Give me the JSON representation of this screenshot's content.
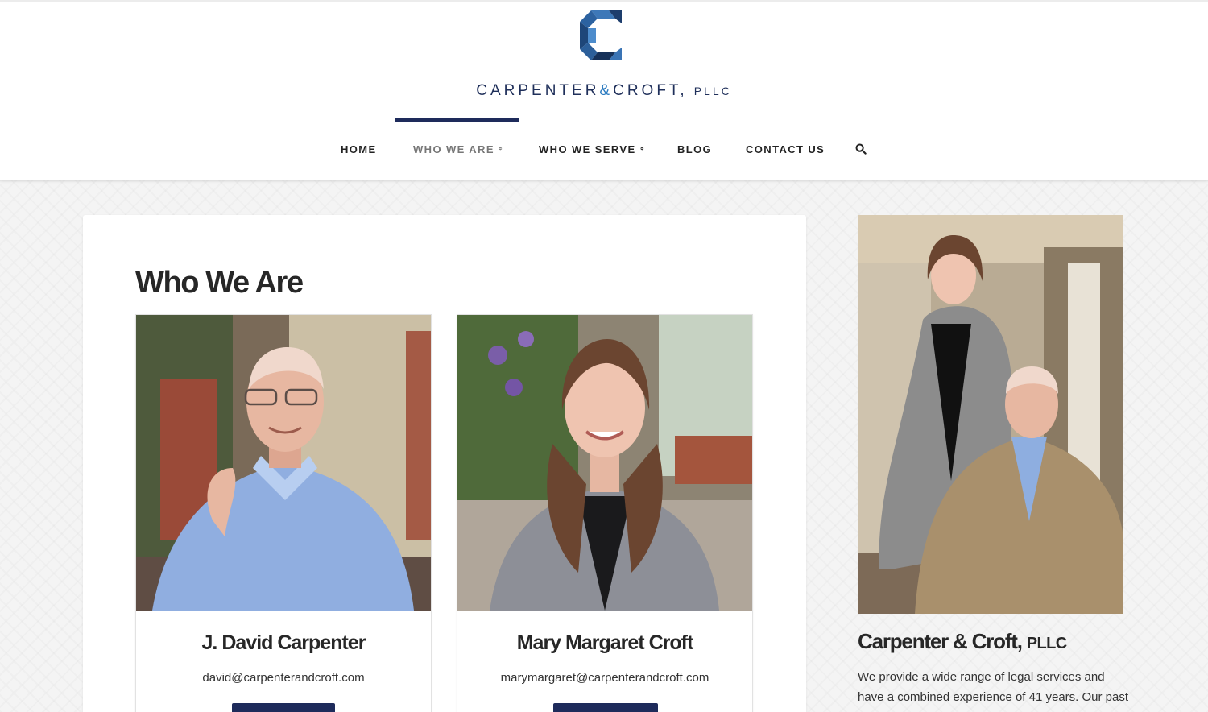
{
  "brand": {
    "name_part1": "CARPENTER",
    "ampersand": "&",
    "name_part2": "CROFT,",
    "suffix": "PLLC",
    "accent_color": "#2c7bc0",
    "navy_color": "#1e2b5b"
  },
  "nav": {
    "items": [
      {
        "label": "HOME",
        "has_dropdown": false,
        "active": false
      },
      {
        "label": "WHO WE ARE",
        "has_dropdown": true,
        "active": true
      },
      {
        "label": "WHO WE SERVE",
        "has_dropdown": true,
        "active": false
      },
      {
        "label": "BLOG",
        "has_dropdown": false,
        "active": false
      },
      {
        "label": "CONTACT US",
        "has_dropdown": false,
        "active": false
      }
    ],
    "dropdown_glyph": "»",
    "search_icon": "search-icon"
  },
  "main": {
    "title": "Who We Are",
    "people": [
      {
        "name": "J. David Carpenter",
        "email": "david@carpenterandcroft.com"
      },
      {
        "name": "Mary Margaret Croft",
        "email": "marymargaret@carpenterandcroft.com"
      }
    ]
  },
  "sidebar": {
    "title_main": "Carpenter & Croft,",
    "title_suffix": "PLLC",
    "text_line1": "We provide a wide range of legal services and",
    "text_line2": "have a combined experience of 41 years. Our past"
  }
}
